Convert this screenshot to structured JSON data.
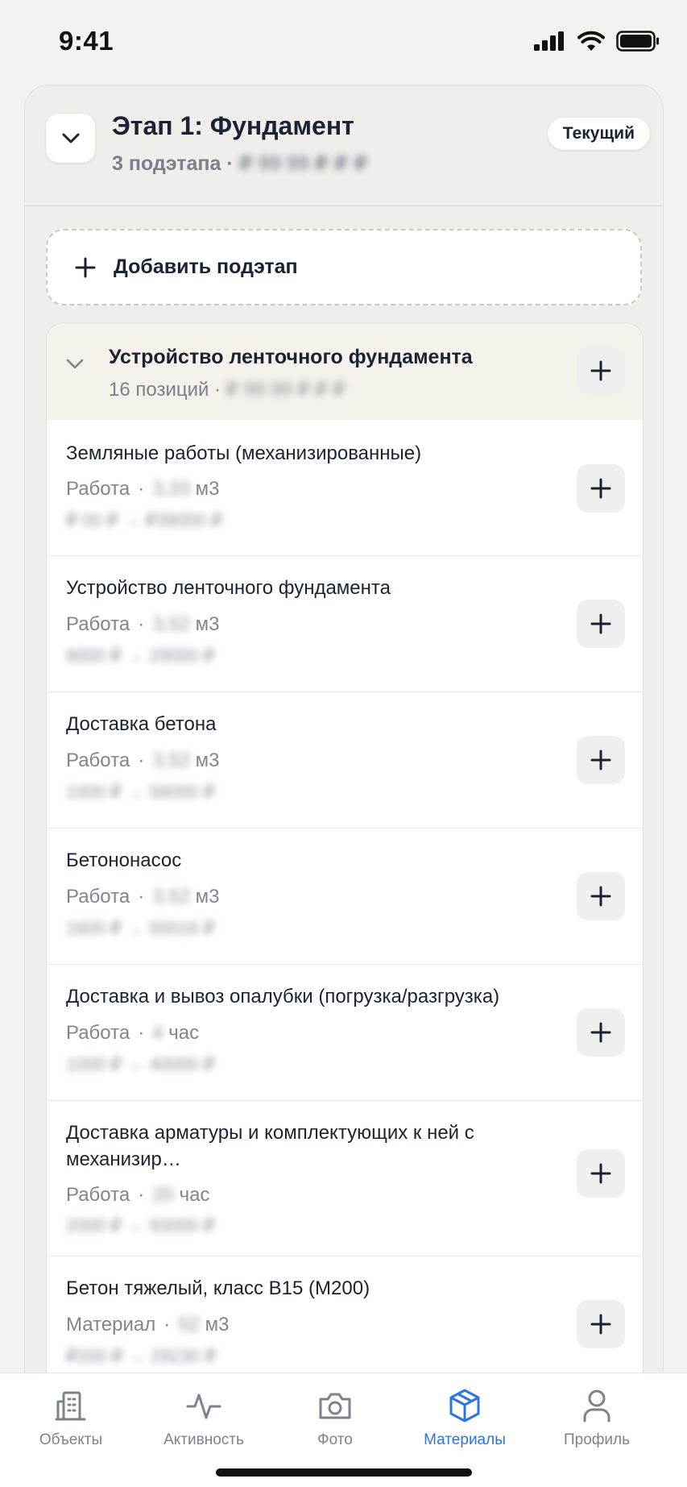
{
  "status": {
    "time": "9:41"
  },
  "stage": {
    "title": "Этап 1: Фундамент",
    "subtitle": "3 подэтапа ·",
    "subtitle_blurred": "₽ 99 99 ₽ ₽ ₽",
    "badge": "Текущий"
  },
  "add_substage": {
    "label": "Добавить подэтап"
  },
  "substage": {
    "title": "Устройство ленточного фундамента",
    "subtitle": "16 позиций ·",
    "subtitle_blurred": "₽ 99 99 ₽ ₽ ₽"
  },
  "items": [
    {
      "name": "Земляные работы (механизированные)",
      "type": "Работа",
      "qty": "3,33",
      "unit": "м3",
      "price": "₽ 00 ₽ → ₽38000 ₽"
    },
    {
      "name": "Устройство ленточного фундамента",
      "type": "Работа",
      "qty": "3,52",
      "unit": "м3",
      "price": "8000 ₽ → 29000 ₽"
    },
    {
      "name": "Доставка бетона",
      "type": "Работа",
      "qty": "3,52",
      "unit": "м3",
      "price": "1000 ₽ → 58000 ₽"
    },
    {
      "name": "Бетононасос",
      "type": "Работа",
      "qty": "3,52",
      "unit": "м3",
      "price": "1600 ₽ → 50016 ₽"
    },
    {
      "name": "Доставка и вывоз опалубки (погрузка/разгрузка)",
      "type": "Работа",
      "qty": "4",
      "unit": "час",
      "price": "1000 ₽ → 40000 ₽"
    },
    {
      "name": "Доставка арматуры и комплектующих к ней с механизир…",
      "type": "Работа",
      "qty": "20",
      "unit": "час",
      "price": "2000 ₽ → 93000 ₽"
    },
    {
      "name": "Бетон тяжелый, класс В15 (М200)",
      "type": "Материал",
      "qty": "52",
      "unit": "м3",
      "price": "₽200 ₽ → 29230 ₽"
    }
  ],
  "tabs": [
    {
      "label": "Объекты",
      "icon": "buildings-icon"
    },
    {
      "label": "Активность",
      "icon": "activity-icon"
    },
    {
      "label": "Фото",
      "icon": "camera-icon"
    },
    {
      "label": "Материалы",
      "icon": "box-icon",
      "active": true
    },
    {
      "label": "Профиль",
      "icon": "user-icon"
    }
  ],
  "colors": {
    "accent": "#2f73e0",
    "text": "#1b2232",
    "muted": "#7b808b",
    "substage_header_bg": "#f5f2ec"
  }
}
